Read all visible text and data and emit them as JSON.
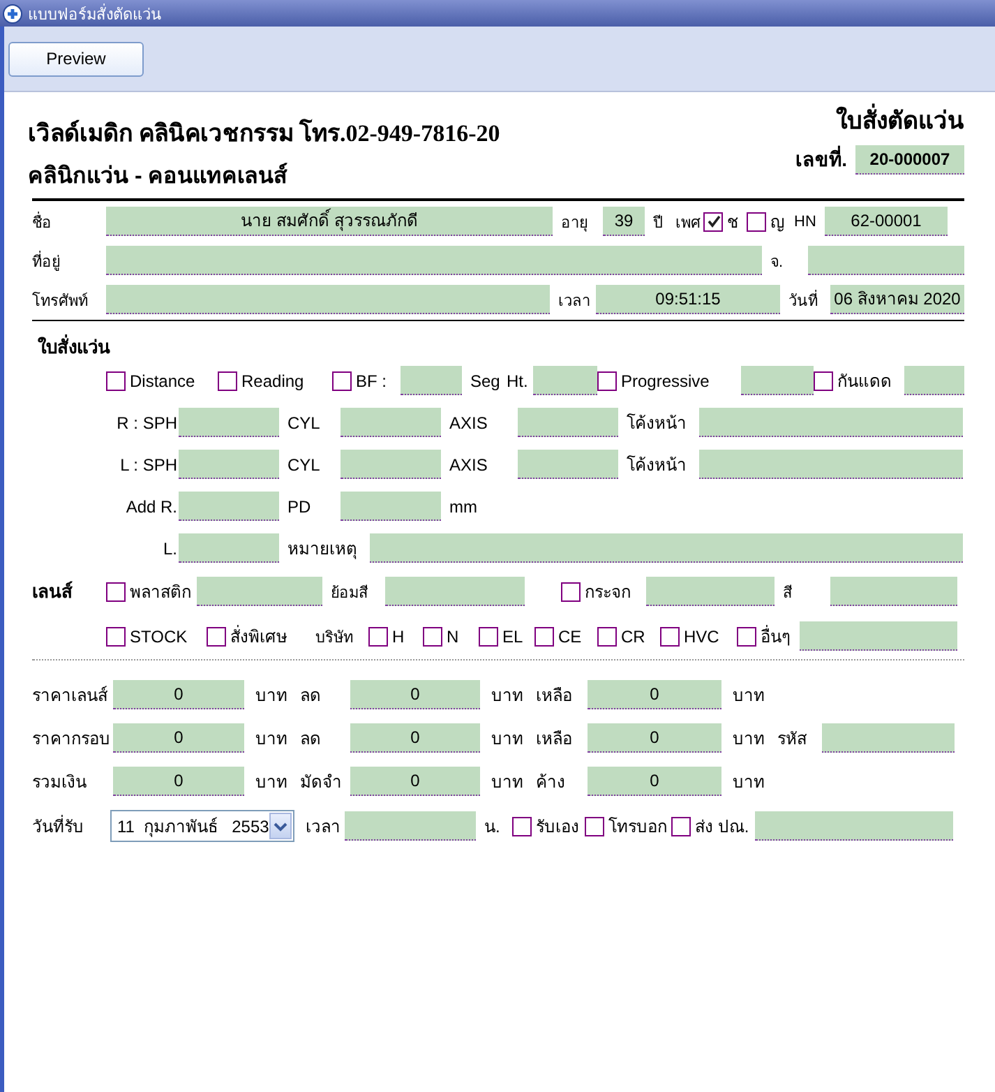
{
  "window": {
    "title": "แบบฟอร์มสั่งตัดแว่น"
  },
  "toolbar": {
    "buttons": [
      "Preview"
    ]
  },
  "header": {
    "clinic": "เวิลด์เมดิก คลินิคเวชกรรม  โทร.02-949-7816-20",
    "subtitle": "คลินิกแว่น - คอนแทคเลนส์",
    "form_title": "ใบสั่งตัดแว่น",
    "number_label": "เลขที่.",
    "number": "20-000007"
  },
  "patient": {
    "lines": [
      {
        "items": [
          {
            "kind": "label",
            "text": "ชื่อ"
          },
          {
            "kind": "field",
            "value": "นาย สมศักดิ์   สุวรรณภักดี"
          },
          {
            "kind": "label",
            "text": "อายุ"
          },
          {
            "kind": "field",
            "value": "39"
          },
          {
            "kind": "label",
            "text": "ปี"
          },
          {
            "kind": "label",
            "text": "เพศ"
          },
          {
            "kind": "check",
            "label": "ช",
            "checked": true
          },
          {
            "kind": "check",
            "label": "ญ",
            "checked": false
          },
          {
            "kind": "label",
            "text": "HN"
          },
          {
            "kind": "field",
            "value": "62-00001"
          }
        ]
      },
      {
        "items": [
          {
            "kind": "label",
            "text": "ที่อยู่"
          },
          {
            "kind": "field"
          },
          {
            "kind": "label",
            "text": "จ."
          },
          {
            "kind": "field"
          }
        ]
      },
      {
        "items": [
          {
            "kind": "label",
            "text": "โทรศัพท์"
          },
          {
            "kind": "field"
          },
          {
            "kind": "label",
            "text": "เวลา"
          },
          {
            "kind": "field",
            "value": "09:51:15"
          },
          {
            "kind": "label",
            "text": "วันที่"
          },
          {
            "kind": "field",
            "value": "06 สิงหาคม 2020"
          }
        ]
      }
    ]
  },
  "glasses": {
    "title": "ใบสั่งแว่น",
    "lines": [
      {
        "items": [
          {
            "kind": "check",
            "label": "Distance",
            "checked": false
          },
          {
            "kind": "check",
            "label": "Reading",
            "checked": false
          },
          {
            "kind": "check",
            "label": "BF :",
            "checked": false
          },
          {
            "kind": "field"
          },
          {
            "kind": "label",
            "text": "Seg"
          },
          {
            "kind": "label",
            "text": "Ht."
          },
          {
            "kind": "field"
          },
          {
            "kind": "check",
            "label": "Progressive",
            "checked": false
          },
          {
            "kind": "field"
          },
          {
            "kind": "check",
            "label": "กันแดด",
            "checked": false
          },
          {
            "kind": "field"
          }
        ]
      },
      {
        "items": [
          {
            "kind": "label",
            "text": "R : SPH"
          },
          {
            "kind": "field"
          },
          {
            "kind": "label",
            "text": "CYL"
          },
          {
            "kind": "field"
          },
          {
            "kind": "label",
            "text": "AXIS"
          },
          {
            "kind": "field"
          },
          {
            "kind": "label",
            "text": "โค้งหน้า"
          },
          {
            "kind": "field"
          }
        ]
      },
      {
        "items": [
          {
            "kind": "label",
            "text": "L : SPH"
          },
          {
            "kind": "field"
          },
          {
            "kind": "label",
            "text": "CYL"
          },
          {
            "kind": "field"
          },
          {
            "kind": "label",
            "text": "AXIS"
          },
          {
            "kind": "field"
          },
          {
            "kind": "label",
            "text": "โค้งหน้า"
          },
          {
            "kind": "field"
          }
        ]
      },
      {
        "items": [
          {
            "kind": "label",
            "text": "Add R."
          },
          {
            "kind": "field"
          },
          {
            "kind": "label",
            "text": "PD"
          },
          {
            "kind": "field"
          },
          {
            "kind": "label",
            "text": "mm"
          }
        ]
      },
      {
        "items": [
          {
            "kind": "label",
            "text": "L."
          },
          {
            "kind": "field"
          },
          {
            "kind": "label",
            "text": "หมายเหตุ"
          },
          {
            "kind": "field"
          }
        ]
      }
    ]
  },
  "lens": {
    "title": "เลนส์",
    "lines": [
      {
        "items": [
          {
            "kind": "check",
            "label": "พลาสติก",
            "checked": false
          },
          {
            "kind": "field"
          },
          {
            "kind": "label",
            "text": "ย้อมสี"
          },
          {
            "kind": "field"
          },
          {
            "kind": "check",
            "label": "กระจก",
            "checked": false
          },
          {
            "kind": "field"
          },
          {
            "kind": "label",
            "text": "สี"
          },
          {
            "kind": "field"
          }
        ]
      },
      {
        "items": [
          {
            "kind": "check",
            "label": "STOCK",
            "checked": false
          },
          {
            "kind": "check",
            "label": "สั่งพิเศษ",
            "checked": false
          },
          {
            "kind": "label",
            "text": "บริษัท"
          },
          {
            "kind": "check",
            "label": "H",
            "checked": false
          },
          {
            "kind": "check",
            "label": "N",
            "checked": false
          },
          {
            "kind": "check",
            "label": "EL",
            "checked": false
          },
          {
            "kind": "check",
            "label": "CE",
            "checked": false
          },
          {
            "kind": "check",
            "label": "CR",
            "checked": false
          },
          {
            "kind": "check",
            "label": "HVC",
            "checked": false
          },
          {
            "kind": "check",
            "label": "อื่นๆ",
            "checked": false
          },
          {
            "kind": "field"
          }
        ]
      }
    ]
  },
  "price": {
    "lines": [
      {
        "items": [
          {
            "kind": "label",
            "text": "ราคาเลนส์"
          },
          {
            "kind": "field",
            "value": "0"
          },
          {
            "kind": "label",
            "text": "บาท"
          },
          {
            "kind": "label",
            "text": "ลด"
          },
          {
            "kind": "field",
            "value": "0"
          },
          {
            "kind": "label",
            "text": "บาท"
          },
          {
            "kind": "label",
            "text": "เหลือ"
          },
          {
            "kind": "field",
            "value": "0"
          },
          {
            "kind": "label",
            "text": "บาท"
          }
        ]
      },
      {
        "items": [
          {
            "kind": "label",
            "text": "ราคากรอบ"
          },
          {
            "kind": "field",
            "value": "0"
          },
          {
            "kind": "label",
            "text": "บาท"
          },
          {
            "kind": "label",
            "text": "ลด"
          },
          {
            "kind": "field",
            "value": "0"
          },
          {
            "kind": "label",
            "text": "บาท"
          },
          {
            "kind": "label",
            "text": "เหลือ"
          },
          {
            "kind": "field",
            "value": "0"
          },
          {
            "kind": "label",
            "text": "บาท"
          },
          {
            "kind": "label",
            "text": "รหัส"
          },
          {
            "kind": "field"
          }
        ]
      },
      {
        "items": [
          {
            "kind": "label",
            "text": "รวมเงิน"
          },
          {
            "kind": "field",
            "value": "0"
          },
          {
            "kind": "label",
            "text": "บาท"
          },
          {
            "kind": "label",
            "text": "มัดจำ"
          },
          {
            "kind": "field",
            "value": "0"
          },
          {
            "kind": "label",
            "text": "บาท"
          },
          {
            "kind": "label",
            "text": "ค้าง"
          },
          {
            "kind": "field",
            "value": "0"
          },
          {
            "kind": "label",
            "text": "บาท"
          }
        ]
      },
      {
        "items": [
          {
            "kind": "label",
            "text": "วันที่รับ"
          },
          {
            "kind": "dropdown",
            "value": "11  กุมภาพันธ์   2553"
          },
          {
            "kind": "label",
            "text": "เวลา"
          },
          {
            "kind": "field"
          },
          {
            "kind": "label",
            "text": "น."
          },
          {
            "kind": "check",
            "label": "รับเอง",
            "checked": false
          },
          {
            "kind": "check",
            "label": "โทรบอก",
            "checked": false
          },
          {
            "kind": "check",
            "label": "ส่ง ปณ.",
            "checked": false
          },
          {
            "kind": "field"
          }
        ]
      }
    ]
  }
}
